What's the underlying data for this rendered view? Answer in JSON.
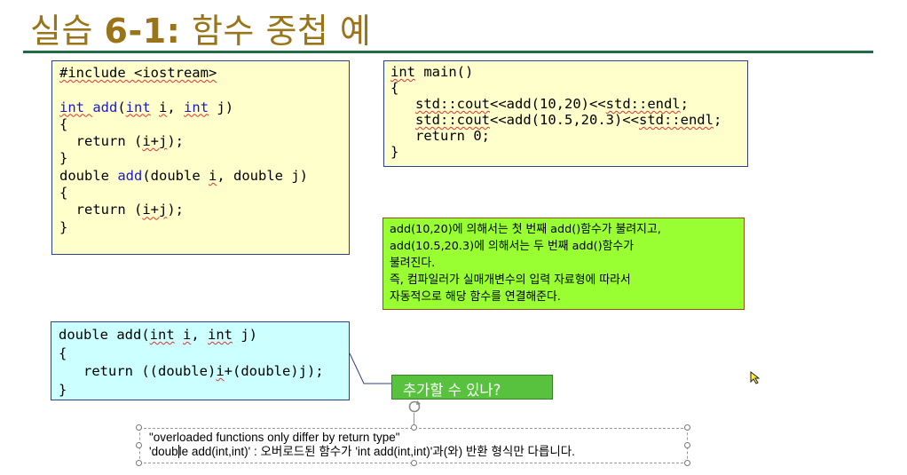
{
  "slide": {
    "title_prefix": "실습 ",
    "title_number": "6-1:",
    "title_suffix": " 함수 중첩 예"
  },
  "code_left": {
    "line1": "#include <iostream>",
    "line2a": "int ",
    "line2b": "add",
    "line2c": "(",
    "line2d": "int",
    "line2e": " ",
    "line2f": "i",
    "line2g": ", ",
    "line2h": "int",
    "line2i": " j)",
    "line3": "{",
    "line4a": "  return (",
    "line4b": "i+j",
    "line4c": ");",
    "line5": "}",
    "line6a": "double ",
    "line6b": "add",
    "line6c": "(double ",
    "line6d": "i",
    "line6e": ", double j)",
    "line7": "{",
    "line8a": "  return (",
    "line8b": "i+j",
    "line8c": ");",
    "line9": "}"
  },
  "code_main": {
    "line1a": "int",
    "line1b": " main()",
    "line2": "{",
    "line3a": "   ",
    "line3b": "std::cout",
    "line3c": "<<add(10,20)<<",
    "line3d": "std::endl",
    "line3e": ";",
    "line4a": "   ",
    "line4b": "std::cout",
    "line4c": "<<add(10.5,20.3)<<",
    "line4d": "std::endl",
    "line4e": ";",
    "line5": "   return 0;",
    "line6": "}"
  },
  "note": {
    "line1": "add(10,20)에 의해서는 첫 번째 add()함수가 불려지고,",
    "line2": "add(10.5,20.3)에 의해서는 두 번째 add()함수가",
    "line3": "불려진다.",
    "line4": "즉, 컴파일러가 실매개변수의 입력 자료형에 따라서",
    "line5": "자동적으로 해당 함수를 연결해준다."
  },
  "code_cyan": {
    "line1a": "double add(",
    "line1b": "int",
    "line1c": " ",
    "line1d": "i",
    "line1e": ", ",
    "line1f": "int",
    "line1g": " j)",
    "line2": "{",
    "line3a": "   return ((double)",
    "line3b": "i",
    "line3c": "+(double)j);",
    "line4": "}"
  },
  "callout": {
    "text": "추가할 수 있나?"
  },
  "textframe": {
    "line1": "\"overloaded functions only differ by return type\"",
    "line2a": "'doub",
    "line2b": "le add(int,int)' : 오버로드된 함수가 'int add(int,int)'과(와) 반환 형식만 다릅니다."
  }
}
